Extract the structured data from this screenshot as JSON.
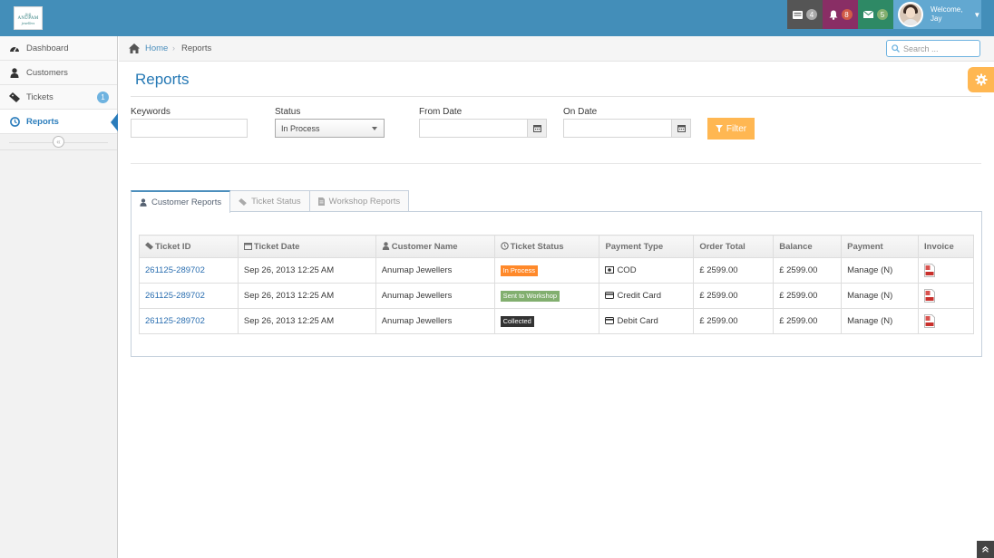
{
  "navbar": {
    "brand": {
      "line1": "ANUPAM",
      "line2": "jewellers"
    },
    "tasks_count": "4",
    "notifications_count": "8",
    "messages_count": "5",
    "user_greeting": "Welcome,",
    "user_name": "Jay"
  },
  "sidebar": {
    "items": [
      {
        "label": "Dashboard",
        "icon": "tachometer-icon"
      },
      {
        "label": "Customers",
        "icon": "user-icon"
      },
      {
        "label": "Tickets",
        "icon": "ticket-icon",
        "badge": "1"
      },
      {
        "label": "Reports",
        "icon": "clock-icon",
        "active": true
      }
    ]
  },
  "breadcrumb": {
    "home": "Home",
    "current": "Reports"
  },
  "search": {
    "placeholder": "Search ..."
  },
  "page": {
    "title": "Reports"
  },
  "filters": {
    "keywords_label": "Keywords",
    "keywords_value": "",
    "status_label": "Status",
    "status_value": "In Process",
    "from_date_label": "From Date",
    "on_date_label": "On Date",
    "filter_button": "Filter"
  },
  "tabs": [
    {
      "label": "Customer Reports",
      "active": true
    },
    {
      "label": "Ticket Status"
    },
    {
      "label": "Workshop Reports"
    }
  ],
  "table": {
    "headers": [
      "Ticket ID",
      "Ticket Date",
      "Customer Name",
      "Ticket Status",
      "Payment Type",
      "Order Total",
      "Balance",
      "Payment",
      "Invoice"
    ],
    "rows": [
      {
        "id": "261125-289702",
        "date": "Sep 26, 2013 12:25 AM",
        "customer": "Anumap Jewellers",
        "status": "In Process",
        "status_color": "#ff892a",
        "payment_type": "COD",
        "order_total": "£ 2599.00",
        "balance": "£ 2599.00",
        "payment": "Manage (N)"
      },
      {
        "id": "261125-289702",
        "date": "Sep 26, 2013 12:25 AM",
        "customer": "Anumap Jewellers",
        "status": "Sent to Workshop",
        "status_color": "#82af6f",
        "payment_type": "Credit Card",
        "order_total": "£ 2599.00",
        "balance": "£ 2599.00",
        "payment": "Manage (N)"
      },
      {
        "id": "261125-289702",
        "date": "Sep 26, 2013 12:25 AM",
        "customer": "Anumap Jewellers",
        "status": "Collected",
        "status_color": "#333333",
        "payment_type": "Debit Card",
        "order_total": "£ 2599.00",
        "balance": "£ 2599.00",
        "payment": "Manage (N)"
      }
    ]
  },
  "colors": {
    "primary": "#438eb9",
    "accent": "#ffb752",
    "link": "#2a6eb0"
  }
}
